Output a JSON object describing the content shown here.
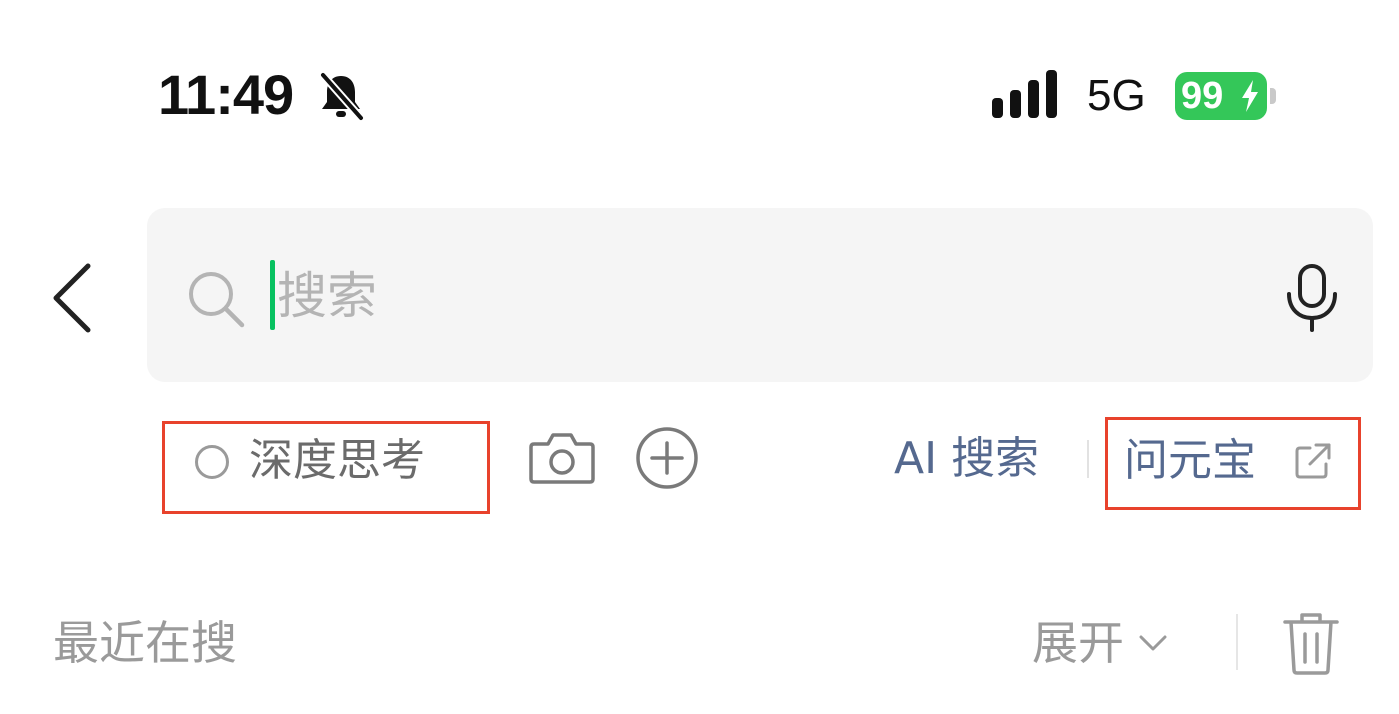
{
  "status_bar": {
    "time": "11:49",
    "network": "5G",
    "battery_level": "99",
    "battery_charging": true,
    "icons": [
      "bell-slash-icon",
      "signal-icon",
      "lightning-bolt-icon"
    ]
  },
  "search": {
    "placeholder": "搜索",
    "value": "",
    "icons": [
      "back-chevron-icon",
      "magnifier-icon",
      "microphone-icon"
    ]
  },
  "options": {
    "deep_think_label": "深度思考",
    "ai_search_label": "AI 搜索",
    "yuanbao_label": "问元宝",
    "icons": [
      "radio-circle-icon",
      "camera-icon",
      "plus-circle-icon",
      "external-link-icon"
    ]
  },
  "recent": {
    "title": "最近在搜",
    "expand_label": "展开",
    "icons": [
      "chevron-down-icon",
      "trash-icon"
    ]
  },
  "colors": {
    "accent_green": "#07c160",
    "battery_green": "#34c759",
    "link_blue": "#55698f",
    "highlight_red": "#e8422c",
    "muted_gray": "#9a9a9a",
    "search_bg": "#f5f5f5"
  }
}
